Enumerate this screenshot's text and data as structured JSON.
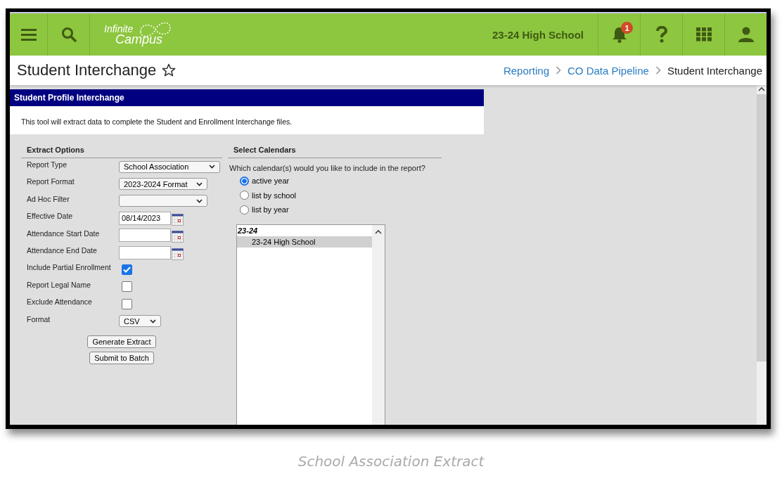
{
  "header": {
    "logo": {
      "line1": "Infinite",
      "line2": "Campus"
    },
    "school": "23-24 High School",
    "notification_count": "1"
  },
  "page": {
    "title": "Student Interchange",
    "favorite": false,
    "breadcrumbs": [
      {
        "label": "Reporting",
        "kind": "link"
      },
      {
        "label": "CO Data Pipeline",
        "kind": "link"
      },
      {
        "label": "Student Interchange",
        "kind": "current"
      }
    ]
  },
  "panel": {
    "title": "Student Profile Interchange",
    "description": "This tool will extract data to complete the Student and Enrollment Interchange files."
  },
  "extract_options": {
    "heading": "Extract Options",
    "fields": [
      {
        "label": "Report Type",
        "kind": "select",
        "value": "School Association"
      },
      {
        "label": "Report Format",
        "kind": "select",
        "value": "2023-2024 Format"
      },
      {
        "label": "Ad Hoc Filter",
        "kind": "select"
      },
      {
        "label": "Effective Date",
        "kind": "date",
        "value": "08/14/2023"
      },
      {
        "label": "Attendance Start Date",
        "kind": "date"
      },
      {
        "label": "Attendance End Date",
        "kind": "date"
      },
      {
        "label": "Include Partial Enrollment",
        "kind": "checkbox",
        "checked": true
      },
      {
        "label": "Report Legal Name",
        "kind": "checkbox",
        "checked": false
      },
      {
        "label": "Exclude Attendance",
        "kind": "checkbox",
        "checked": false
      },
      {
        "label": "Format",
        "kind": "select",
        "value": "CSV"
      }
    ],
    "buttons": [
      "Generate Extract",
      "Submit to Batch"
    ]
  },
  "calendars": {
    "heading": "Select Calendars",
    "question": "Which calendar(s) would you like to include in the report?",
    "options": [
      {
        "label": "active year",
        "selected": true
      },
      {
        "label": "list by school",
        "selected": false
      },
      {
        "label": "list by year",
        "selected": false
      }
    ],
    "groups": [
      {
        "label": "23-24",
        "items": [
          {
            "label": "23-24 High School",
            "selected": true
          }
        ]
      }
    ]
  },
  "caption": "School Association Extract"
}
